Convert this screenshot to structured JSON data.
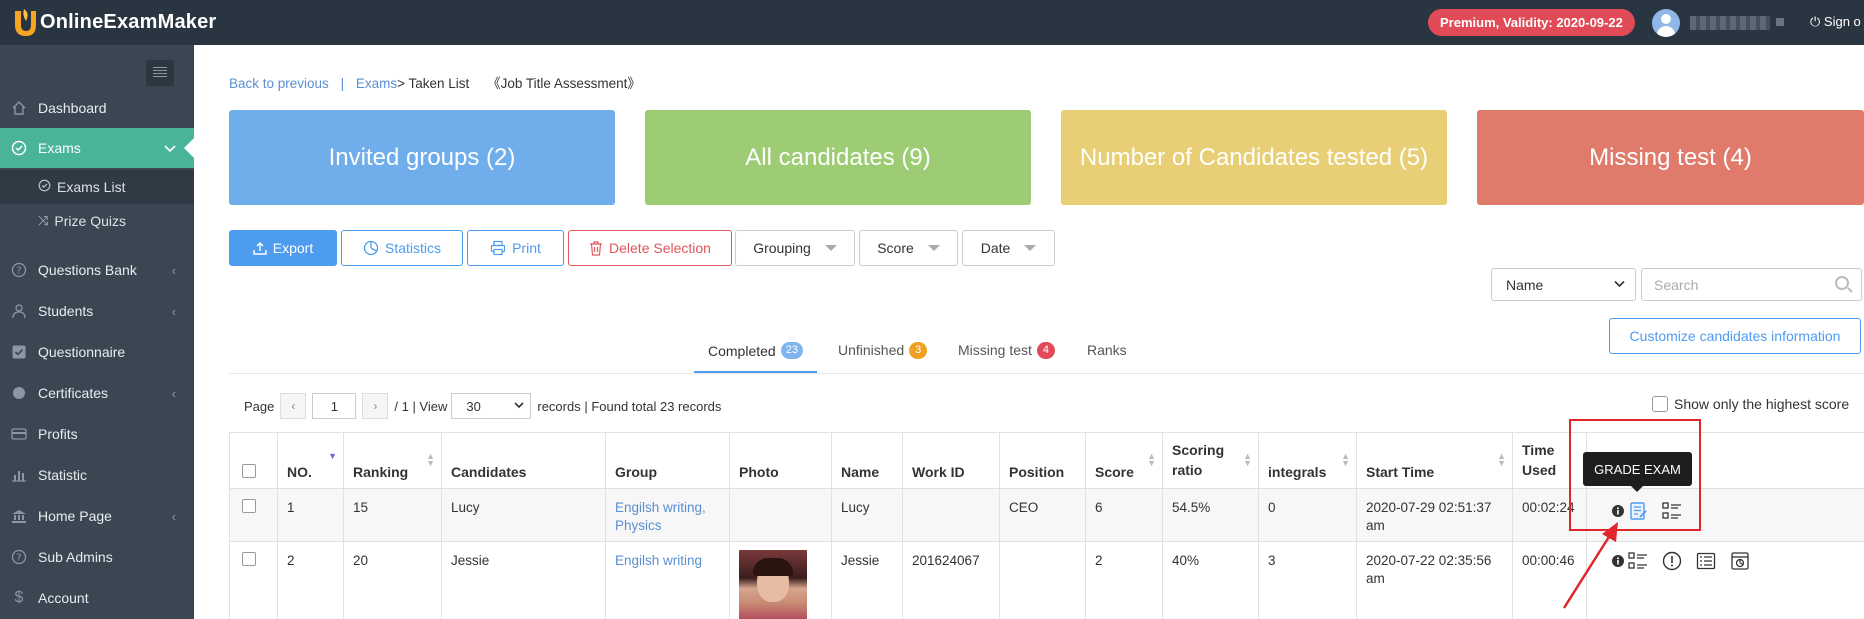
{
  "app": {
    "logo_text": "OnlineExamMaker",
    "premium_badge": "Premium, Validity: 2020-09-22",
    "sign_out": "Sign o",
    "colors": {
      "topbar": "#2a3542",
      "sidebar": "#3a4652",
      "active": "#49b49a",
      "accent": "#4d9cf0"
    }
  },
  "sidebar": {
    "items": [
      {
        "label": "Dashboard",
        "icon": "home-icon"
      },
      {
        "label": "Exams",
        "icon": "check-circle-icon",
        "active": true
      },
      {
        "label": "Questions Bank",
        "icon": "question-circle-icon"
      },
      {
        "label": "Students",
        "icon": "user-icon"
      },
      {
        "label": "Questionnaire",
        "icon": "checkbox-icon"
      },
      {
        "label": "Certificates",
        "icon": "dot-icon"
      },
      {
        "label": "Profits",
        "icon": "card-icon"
      },
      {
        "label": "Statistic",
        "icon": "bar-chart-icon"
      },
      {
        "label": "Home Page",
        "icon": "bank-icon"
      },
      {
        "label": "Sub Admins",
        "icon": "question-circle-icon"
      },
      {
        "label": "Account",
        "icon": "dollar-icon"
      }
    ],
    "sub_items": [
      {
        "label": "Exams List",
        "icon": "check-circle-icon"
      },
      {
        "label": "Prize Quizs",
        "icon": "shuffle-icon"
      }
    ]
  },
  "breadcrumb": {
    "back": "Back to previous",
    "sep": "|",
    "exams": "Exams",
    "current": "> Taken List",
    "exam_name": "《Job Title Assessment》"
  },
  "cards": [
    {
      "label": "Invited groups (2)",
      "color": "#6fadeb"
    },
    {
      "label": "All candidates (9)",
      "color": "#9dcc74"
    },
    {
      "label": "Number of Candidates tested (5)",
      "color": "#e8cf75"
    },
    {
      "label": "Missing test (4)",
      "color": "#e07b6c"
    }
  ],
  "toolbar": {
    "export": "Export",
    "statistics": "Statistics",
    "print": "Print",
    "delete": "Delete Selection",
    "grouping": "Grouping",
    "score": "Score",
    "date": "Date"
  },
  "filter": {
    "field": "Name",
    "search_placeholder": "Search"
  },
  "tabs": [
    {
      "label": "Completed",
      "badge": "23",
      "badge_color": "#7fb4ef"
    },
    {
      "label": "Unfinished",
      "badge": "3",
      "badge_color": "#f0a020"
    },
    {
      "label": "Missing test",
      "badge": "4",
      "badge_color": "#e04b57"
    },
    {
      "label": "Ranks",
      "badge": ""
    }
  ],
  "customize_button": "Customize candidates information",
  "pager": {
    "page_label": "Page",
    "page": "1",
    "total": "/ 1 | View",
    "per_page": "30",
    "records_text": "records | Found total 23 records"
  },
  "highest_only": "Show only the highest score",
  "table": {
    "headers": [
      "NO.",
      "Ranking",
      "Candidates",
      "Group",
      "Photo",
      "Name",
      "Work ID",
      "Position",
      "Score",
      "Scoring ratio",
      "integrals",
      "Start Time",
      "Time Used"
    ],
    "rows": [
      {
        "no": "1",
        "ranking": "15",
        "candidate": "Lucy",
        "group": "Engilsh writing, Physics",
        "name": "Lucy",
        "work_id": "",
        "position": "CEO",
        "score": "6",
        "ratio": "54.5%",
        "integrals": "0",
        "start": "2020-07-29 02:51:37 am",
        "time_used": "00:02:24"
      },
      {
        "no": "2",
        "ranking": "20",
        "candidate": "Jessie",
        "group": "Engilsh writing",
        "name": "Jessie",
        "work_id": "201624067",
        "position": "",
        "score": "2",
        "ratio": "40%",
        "integrals": "3",
        "start": "2020-07-22 02:35:56 am",
        "time_used": "00:00:46"
      }
    ]
  },
  "tooltip": "GRADE EXAM"
}
